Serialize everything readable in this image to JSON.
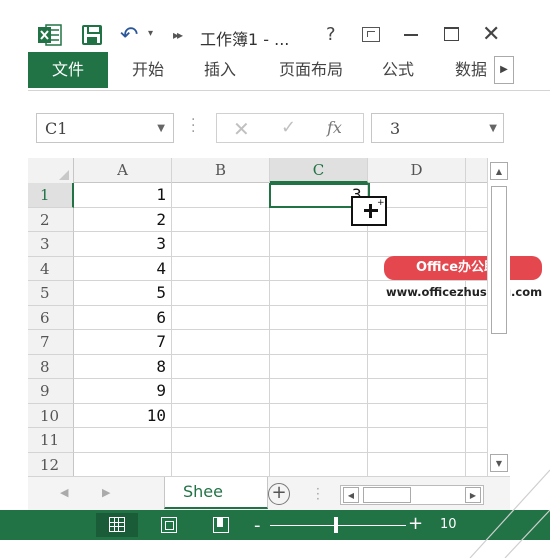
{
  "titlebar": {
    "title": "工作簿1 - ...",
    "icons": [
      "excel-icon",
      "save-icon",
      "undo-icon",
      "customize-icon",
      "help-icon",
      "ribbon-display-icon",
      "minimize-icon",
      "maximize-icon",
      "close-icon"
    ],
    "help": "?",
    "close": "✕"
  },
  "ribbon": {
    "tabs": [
      {
        "label": "文件"
      },
      {
        "label": "开始"
      },
      {
        "label": "插入"
      },
      {
        "label": "页面布局"
      },
      {
        "label": "公式"
      },
      {
        "label": "数据"
      }
    ]
  },
  "formula_bar": {
    "name_box": "C1",
    "fx": "fx",
    "value": "3"
  },
  "grid": {
    "columns": [
      "A",
      "B",
      "C",
      "D"
    ],
    "selected_column": "C",
    "rows": [
      "1",
      "2",
      "3",
      "4",
      "5",
      "6",
      "7",
      "8",
      "9",
      "10",
      "11",
      "12"
    ],
    "column_a_values": [
      "1",
      "2",
      "3",
      "4",
      "5",
      "6",
      "7",
      "8",
      "9",
      "10",
      "",
      ""
    ],
    "selected_cell_value": "3"
  },
  "watermark": {
    "badge": "Office办公助手",
    "url": "www.officezhushou.com"
  },
  "sheets": {
    "active": "Shee"
  },
  "statusbar": {
    "zoom_level": "10"
  },
  "colors": {
    "accent": "#217346",
    "watermark": "#e4474e"
  }
}
